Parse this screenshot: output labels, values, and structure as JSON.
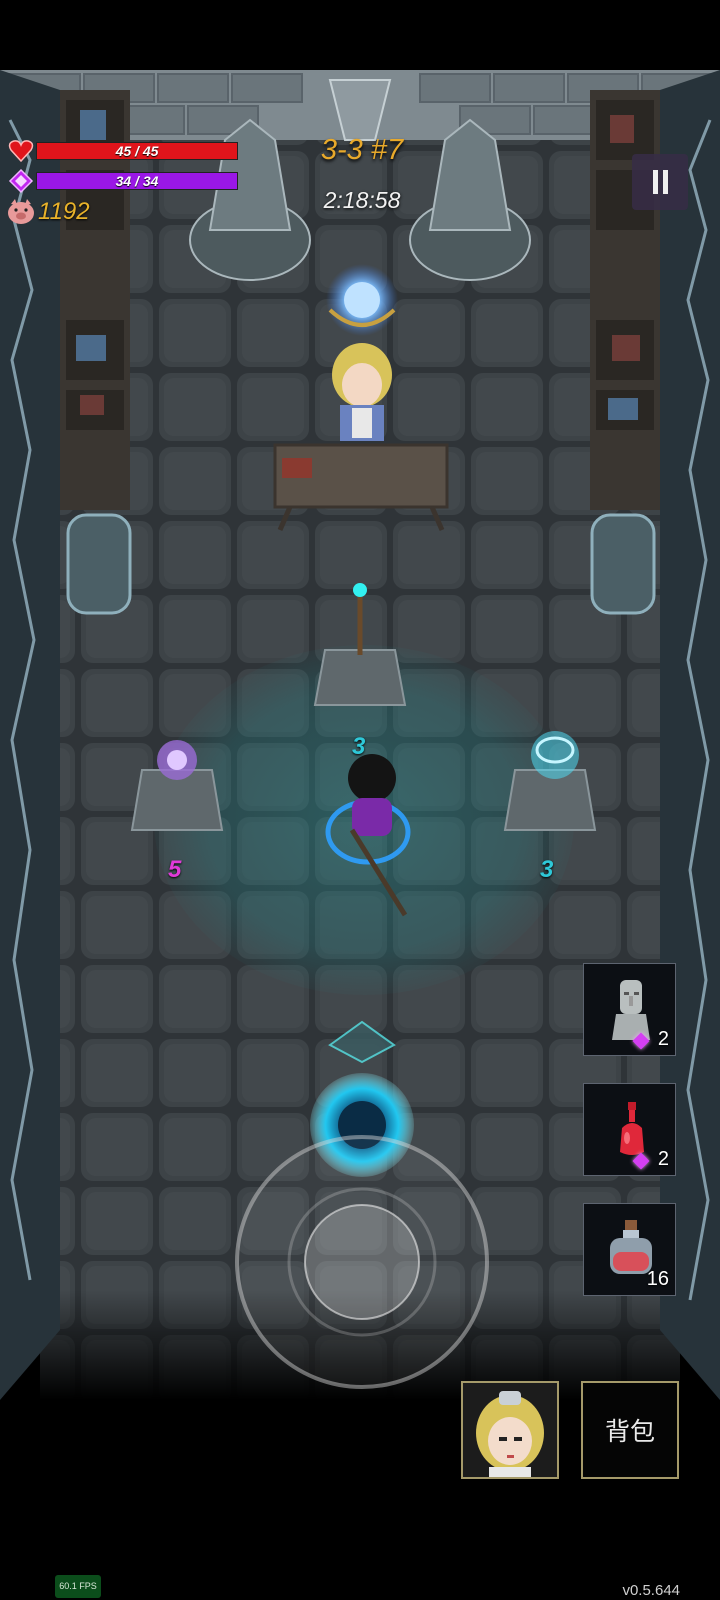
{
  "hud": {
    "hp_text": "45 / 45",
    "hp_fraction": 1.0,
    "mp_text": "34 / 34",
    "mp_fraction": 1.0,
    "coins": "1192",
    "stage": "3-3 #7",
    "timer": "2:18:58"
  },
  "pedestals": {
    "center": "3",
    "left": "5",
    "right": "3"
  },
  "slots": [
    {
      "icon": "moai-statue-icon",
      "count": "2",
      "gem_cost": true
    },
    {
      "icon": "red-potion-icon",
      "count": "2",
      "gem_cost": true
    },
    {
      "icon": "health-flask-icon",
      "count": "16",
      "gem_cost": false
    }
  ],
  "buttons": {
    "bag_label": "背包"
  },
  "debug": {
    "fps": "60.1 FPS",
    "version": "v0.5.644"
  },
  "colors": {
    "hp": "#e0141b",
    "mp": "#9a17e6",
    "coin": "#e8b22a",
    "stage": "#e8a92b",
    "cyan": "#2ec8d8",
    "magenta": "#e03ad8"
  }
}
